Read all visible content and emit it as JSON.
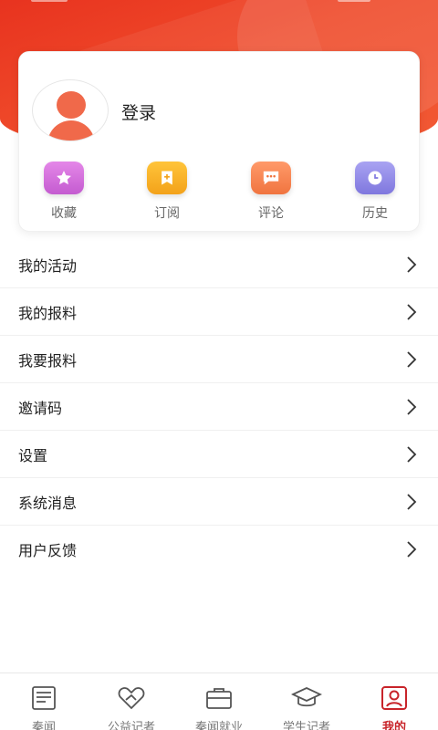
{
  "profile": {
    "login_label": "登录"
  },
  "quick_actions": [
    {
      "label": "收藏",
      "icon": "star-icon"
    },
    {
      "label": "订阅",
      "icon": "subscribe-icon"
    },
    {
      "label": "评论",
      "icon": "comment-icon"
    },
    {
      "label": "历史",
      "icon": "clock-icon"
    }
  ],
  "menu": [
    {
      "label": "我的活动"
    },
    {
      "label": "我的报料"
    },
    {
      "label": "我要报料"
    },
    {
      "label": "邀请码"
    },
    {
      "label": "设置"
    },
    {
      "label": "系统消息"
    },
    {
      "label": "用户反馈"
    }
  ],
  "tabs": [
    {
      "label": "秦闻",
      "icon": "news-icon"
    },
    {
      "label": "公益记者",
      "icon": "charity-icon"
    },
    {
      "label": "秦闻就业",
      "icon": "briefcase-icon"
    },
    {
      "label": "学生记者",
      "icon": "graduation-cap-icon"
    },
    {
      "label": "我的",
      "icon": "profile-icon",
      "active": true
    }
  ],
  "colors": {
    "brand_red": "#e8331f",
    "tab_active": "#c8242a",
    "avatar": "#f0694a"
  }
}
